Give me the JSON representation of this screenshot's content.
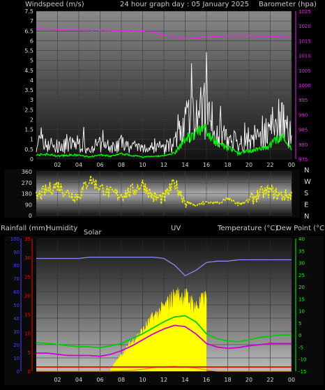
{
  "header": {
    "left": "Windspeed (m/s)",
    "center": "24 hour graph day : 05 January 2025",
    "right": "Barometer (hpa)"
  },
  "direction_letters": [
    "N",
    "W",
    "S",
    "E",
    "N"
  ],
  "bottom_header": {
    "rainfall": "Rainfall (mm)",
    "humidity": "Humidity",
    "solar": "Solar",
    "uv": "UV",
    "temperature": "Temperature (°C)",
    "dewpoint": "Dew Point (°C)"
  },
  "x_ticks": [
    "02",
    "04",
    "06",
    "08",
    "10",
    "12",
    "14",
    "16",
    "18",
    "20",
    "22",
    "00"
  ],
  "colors": {
    "wind": "#ffffff",
    "gust_avg": "#00ee00",
    "barometer": "#ee22ee",
    "direction": "#eeee00",
    "humidity": "#8888ff",
    "solar": "#ffff00",
    "temperature": "#00cc00",
    "dewpoint": "#cc00cc",
    "uv": "#ff2200",
    "rain_axis": "#4444ff",
    "humidity_axis": "#ff0000",
    "temp_axis": "#00ff00"
  },
  "chart_data": [
    {
      "type": "line",
      "title": "24 hour graph day : 05 January 2025",
      "x_hours": [
        0,
        1,
        2,
        3,
        4,
        5,
        6,
        7,
        8,
        9,
        10,
        11,
        12,
        13,
        14,
        15,
        16,
        17,
        18,
        19,
        20,
        21,
        22,
        23,
        24
      ],
      "wind_axis": {
        "label": "Windspeed (m/s)",
        "ticks": [
          "0",
          "0.5",
          "1",
          "1.5",
          "2",
          "2.5",
          "3",
          "3.5",
          "4",
          "4.5",
          "5",
          "5.5",
          "6",
          "6.5",
          "7",
          "7.5"
        ],
        "ylim": [
          0,
          7.5
        ]
      },
      "barometer_axis": {
        "label": "Barometer (hpa)",
        "ticks": [
          "975",
          "980",
          "985",
          "990",
          "995",
          "1000",
          "1005",
          "1010",
          "1015",
          "1020",
          "1025"
        ],
        "ylim": [
          975,
          1025
        ]
      },
      "series": [
        {
          "name": "Windspeed",
          "values": [
            0.9,
            0.8,
            0.6,
            0.7,
            0.8,
            0.6,
            0.7,
            0.5,
            0.8,
            0.6,
            0.5,
            0.6,
            0.5,
            0.7,
            1.8,
            2.3,
            2.4,
            1.4,
            1.1,
            0.8,
            1.0,
            1.1,
            1.2,
            2.0,
            1.0
          ]
        },
        {
          "name": "Average wind",
          "values": [
            0.2,
            0.25,
            0.15,
            0.2,
            0.2,
            0.1,
            0.2,
            0.15,
            0.25,
            0.2,
            0.1,
            0.15,
            0.15,
            0.3,
            1.0,
            1.3,
            1.5,
            0.8,
            0.6,
            0.3,
            0.4,
            0.5,
            0.7,
            1.2,
            0.5
          ]
        },
        {
          "name": "Barometer",
          "values": [
            1019.2,
            1019.0,
            1018.8,
            1018.6,
            1018.6,
            1018.5,
            1018.5,
            1018.4,
            1018.4,
            1018.4,
            1018.3,
            1017.9,
            1016.9,
            1016.2,
            1015.7,
            1015.9,
            1016.3,
            1016.5,
            1016.6,
            1016.7,
            1016.7,
            1016.5,
            1016.5,
            1016.3,
            1016.2
          ]
        }
      ]
    },
    {
      "type": "scatter",
      "title": "",
      "direction_axis": {
        "ticks": [
          "0",
          "90",
          "180",
          "270",
          "360"
        ],
        "ylim": [
          0,
          360
        ]
      },
      "series": [
        {
          "name": "Wind direction",
          "values": [
            150,
            210,
            250,
            180,
            160,
            300,
            230,
            180,
            170,
            200,
            260,
            150,
            140,
            270,
            120,
            80,
            110,
            100,
            140,
            90,
            120,
            180,
            200,
            160,
            170
          ]
        }
      ]
    },
    {
      "type": "area",
      "title": "",
      "left_axes": {
        "rainfall": {
          "label": "Rainfall (mm)",
          "ticks": [
            "0",
            "10",
            "20",
            "30",
            "40",
            "50",
            "60",
            "70",
            "80",
            "90",
            "100"
          ],
          "ylim": [
            0,
            100
          ]
        },
        "humidity": {
          "label": "Humidity",
          "ticks": [
            "0",
            "5",
            "10",
            "15",
            "20",
            "25",
            "30",
            "35"
          ],
          "ylim": [
            0,
            35
          ]
        }
      },
      "right_axis": {
        "label": "Temperature (°C)",
        "ticks": [
          "-15",
          "-10",
          "-5",
          "0",
          "5",
          "10",
          "15",
          "20",
          "25",
          "30",
          "35",
          "40"
        ],
        "ylim": [
          -15,
          40
        ]
      },
      "series": [
        {
          "name": "Humidity",
          "values": [
            85,
            85,
            85,
            85,
            85,
            86,
            86,
            86,
            86,
            86,
            86,
            86,
            85,
            80,
            72,
            76,
            82,
            83,
            83,
            84,
            84,
            84,
            84,
            84,
            84
          ]
        },
        {
          "name": "Solar",
          "values": [
            0,
            0,
            0,
            0,
            0,
            0,
            0,
            2,
            12,
            22,
            30,
            40,
            47,
            56,
            56,
            48,
            55,
            0,
            0,
            0,
            0,
            0,
            0,
            0,
            0
          ]
        },
        {
          "name": "Temperature",
          "values": [
            -3.2,
            -3.5,
            -3.8,
            -4.5,
            -4.8,
            -4.9,
            -5.2,
            -4.5,
            -3.5,
            -1.5,
            0.5,
            3.0,
            5.5,
            7.5,
            8.0,
            5.5,
            0.5,
            -1.5,
            -2.5,
            -2.8,
            -2.0,
            -1.0,
            -0.5,
            0.0,
            0.0
          ]
        },
        {
          "name": "Dew Point",
          "values": [
            -7.5,
            -7.5,
            -8.0,
            -8.5,
            -8.5,
            -8.5,
            -8.8,
            -8.0,
            -6.5,
            -4.5,
            -2.0,
            0.5,
            2.5,
            4.0,
            3.5,
            0.5,
            -3.5,
            -5.0,
            -5.5,
            -5.2,
            -4.5,
            -4.0,
            -3.5,
            -3.5,
            -3.5
          ]
        },
        {
          "name": "UV",
          "values": [
            0,
            0,
            0,
            0,
            0,
            0,
            0,
            0,
            0.1,
            0.2,
            0.5,
            0.9,
            1.2,
            1.3,
            1.1,
            0.8,
            0.3,
            0,
            0,
            0,
            0,
            0,
            0,
            0,
            0
          ]
        }
      ]
    }
  ]
}
